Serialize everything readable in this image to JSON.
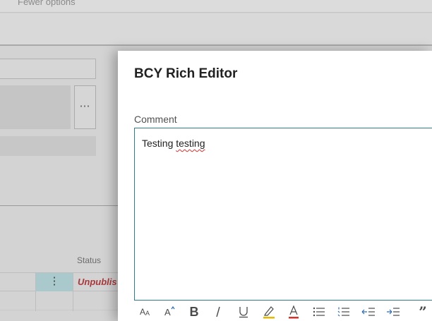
{
  "background": {
    "fewer_options": "Fewer options",
    "more_menu_label": "⋯",
    "status_header": "Status",
    "row_menu_label": "⋮",
    "row_status": "Unpublis"
  },
  "dialog": {
    "title": "BCY Rich Editor",
    "field_label": "Comment",
    "text_before": "Testing ",
    "text_misspelled": "testing"
  },
  "toolbar": {
    "buttons": [
      {
        "icon": "font-size-icon"
      },
      {
        "icon": "superscript-icon"
      },
      {
        "icon": "bold-icon",
        "label": "B"
      },
      {
        "icon": "italic-icon"
      },
      {
        "icon": "underline-icon"
      },
      {
        "icon": "highlight-icon",
        "color": "#e6b800"
      },
      {
        "icon": "font-color-icon",
        "color": "#d6312b"
      },
      {
        "icon": "bullet-list-icon"
      },
      {
        "icon": "numbered-list-icon"
      },
      {
        "icon": "decrease-indent-icon",
        "color": "#2b6cb0"
      },
      {
        "icon": "increase-indent-icon",
        "color": "#2b6cb0"
      },
      {
        "icon": "quote-icon",
        "label": "”"
      }
    ]
  },
  "colors": {
    "editor_border": "#2e7d8a",
    "row_selected": "#a9c9cc",
    "unpublished": "#a8393b"
  }
}
